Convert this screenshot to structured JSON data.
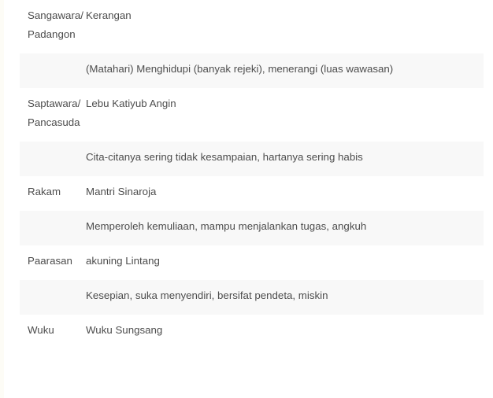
{
  "rows": [
    {
      "label": "Sangawara/Padangon",
      "value": "Kerangan"
    },
    {
      "label": "",
      "value": "(Matahari) Menghidupi (banyak rejeki), menerangi (luas wawasan)"
    },
    {
      "label": "Saptawara/Pancasuda",
      "value": "Lebu Katiyub Angin"
    },
    {
      "label": "",
      "value": "Cita-citanya sering tidak kesampaian, hartanya sering habis"
    },
    {
      "label": "Rakam",
      "value": "Mantri Sinaroja"
    },
    {
      "label": "",
      "value": "Memperoleh kemuliaan, mampu menjalankan tugas, angkuh"
    },
    {
      "label": "Paarasan",
      "value": "akuning Lintang"
    },
    {
      "label": "",
      "value": "Kesepian, suka menyendiri, bersifat pendeta, miskin"
    },
    {
      "label": "Wuku",
      "value": "Wuku Sungsang"
    }
  ]
}
